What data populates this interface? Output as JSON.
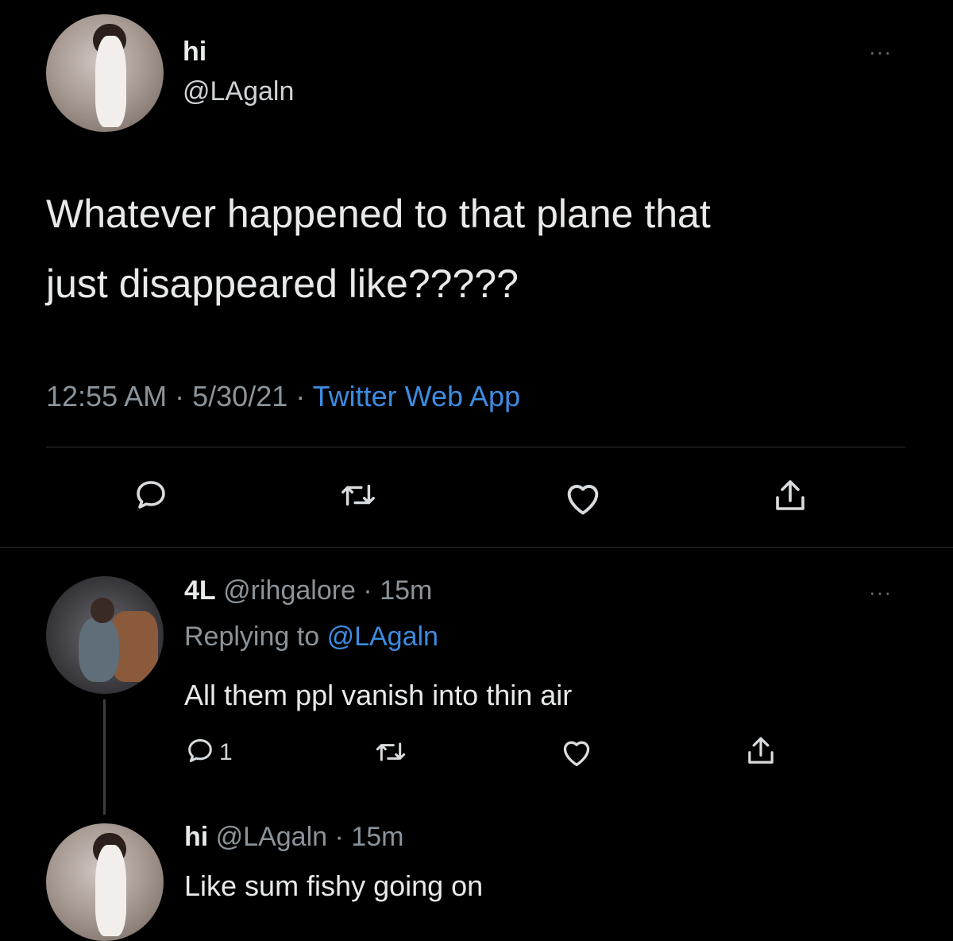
{
  "main_tweet": {
    "display_name": "hi",
    "handle": "@LAgaln",
    "text_line1": "Whatever happened to that plane that",
    "text_line2": "just disappeared like?????",
    "time": "12:55 AM",
    "sep1": "·",
    "date": "5/30/21",
    "sep2": "·",
    "source": "Twitter Web App",
    "more": "···"
  },
  "reply1": {
    "display_name": "4L",
    "handle": "@rihgalore",
    "sep": "·",
    "age": "15m",
    "replying_prefix": "Replying to",
    "replying_handle": "@LAgaln",
    "text": "All them ppl vanish into thin air",
    "reply_count": "1",
    "more": "···"
  },
  "reply2": {
    "display_name": "hi",
    "handle": "@LAgaln",
    "sep": "·",
    "age": "15m",
    "text": "Like sum fishy going on"
  },
  "icons": {
    "reply": "reply-icon",
    "retweet": "retweet-icon",
    "like": "heart-icon",
    "share": "share-icon",
    "more": "more-icon"
  },
  "colors": {
    "background": "#000000",
    "text": "#e7e9ea",
    "muted": "#8b949a",
    "link": "#3d8ce0",
    "divider": "#2f3336"
  }
}
